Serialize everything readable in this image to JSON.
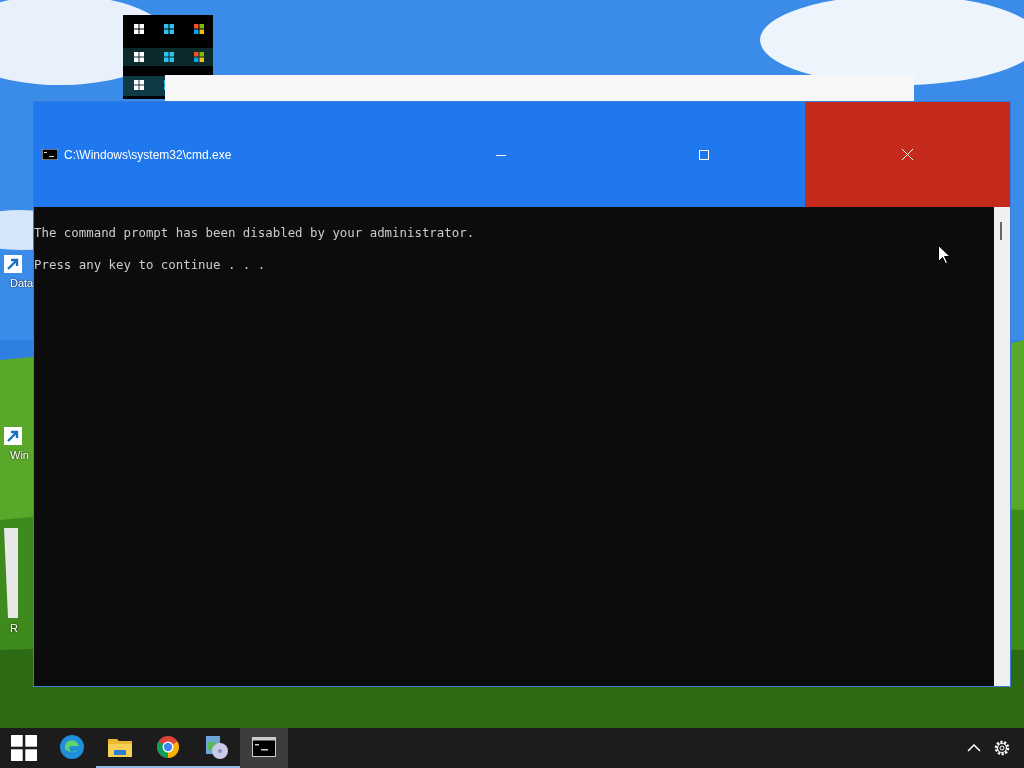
{
  "desktop_icons": [
    {
      "kind": "shortcut",
      "label": "Data"
    },
    {
      "kind": "shortcut",
      "label": "Win"
    },
    {
      "kind": "bin",
      "label": "R"
    }
  ],
  "window": {
    "title": "C:\\Windows\\system32\\cmd.exe",
    "lines": [
      "The command prompt has been disabled by your administrator.",
      "Press any key to continue . . ."
    ]
  },
  "taskbar": {
    "apps": [
      {
        "kind": "edge",
        "running": false,
        "selected": false
      },
      {
        "kind": "folder",
        "running": true,
        "selected": false
      },
      {
        "kind": "chrome",
        "running": true,
        "selected": false
      },
      {
        "kind": "disc",
        "running": true,
        "selected": false
      },
      {
        "kind": "console",
        "running": false,
        "selected": true
      }
    ]
  }
}
